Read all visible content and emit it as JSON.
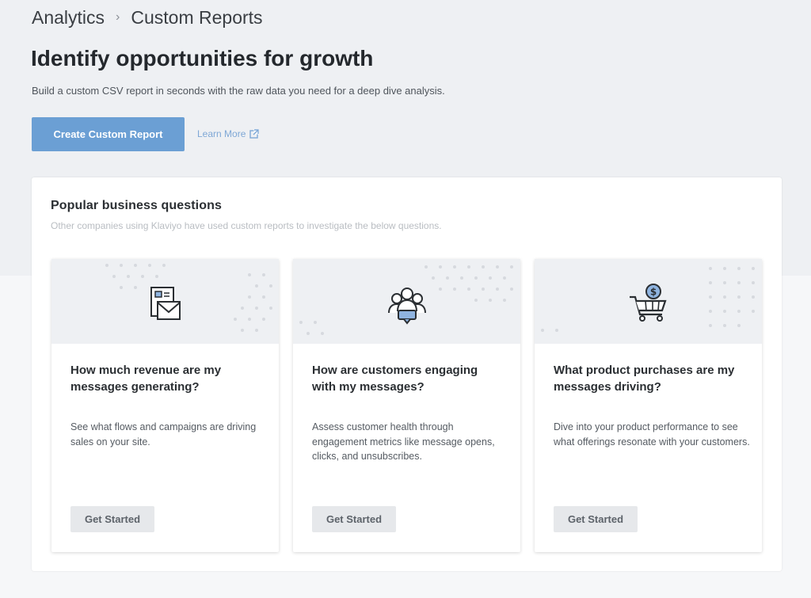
{
  "breadcrumb": {
    "items": [
      "Analytics",
      "Custom Reports"
    ],
    "separator": "›"
  },
  "header": {
    "title": "Identify opportunities for growth",
    "subtitle": "Build a custom CSV report in seconds with the raw data you need for a deep dive analysis."
  },
  "actions": {
    "create_label": "Create Custom Report",
    "learn_more_label": "Learn More",
    "learn_more_icon": "external-link-icon"
  },
  "panel": {
    "title": "Popular business questions",
    "subtitle": "Other companies using Klaviyo have used custom reports to investigate the below questions.",
    "cards": [
      {
        "icon": "email-newsletter-icon",
        "question": "How much revenue are my messages generating?",
        "description": "See what flows and campaigns are driving sales on your site.",
        "button": "Get Started"
      },
      {
        "icon": "customers-chat-icon",
        "question": "How are customers engaging with my messages?",
        "description": "Assess customer health through engagement metrics like message opens, clicks, and unsubscribes.",
        "button": "Get Started"
      },
      {
        "icon": "shopping-cart-dollar-icon",
        "question": "What product purchases are my messages driving?",
        "description": "Dive into your product performance to see what offerings resonate with your customers.",
        "button": "Get Started"
      }
    ]
  },
  "colors": {
    "primary": "#6b9fd4",
    "link": "#7fa8d6",
    "hero_bg": "#eef0f3",
    "icon_accent": "#8fb4e0"
  }
}
